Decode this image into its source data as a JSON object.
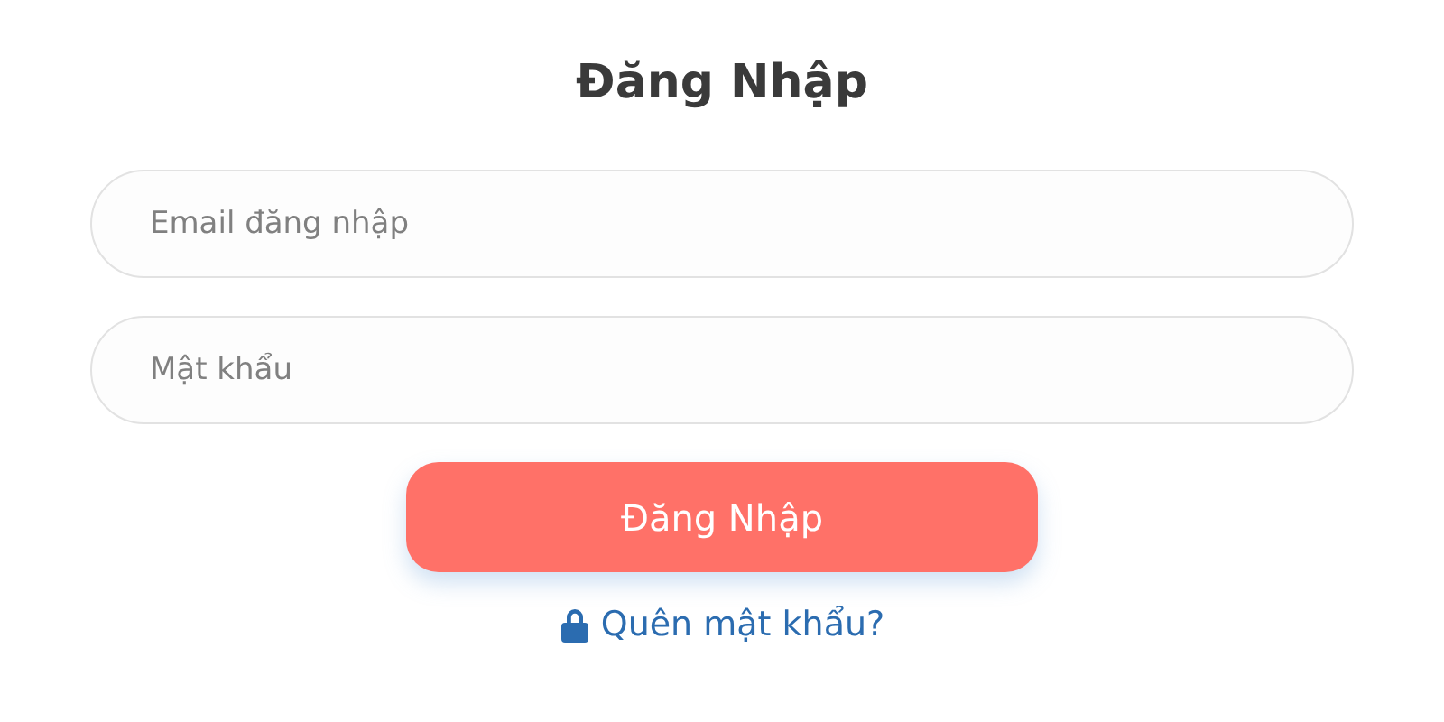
{
  "title": "Đăng Nhập",
  "fields": [
    {
      "placeholder": "Email đăng nhập"
    },
    {
      "placeholder": "Mật khẩu"
    }
  ],
  "submit_button": "Đăng Nhập",
  "forgot_link": "Quên mật khẩu?"
}
